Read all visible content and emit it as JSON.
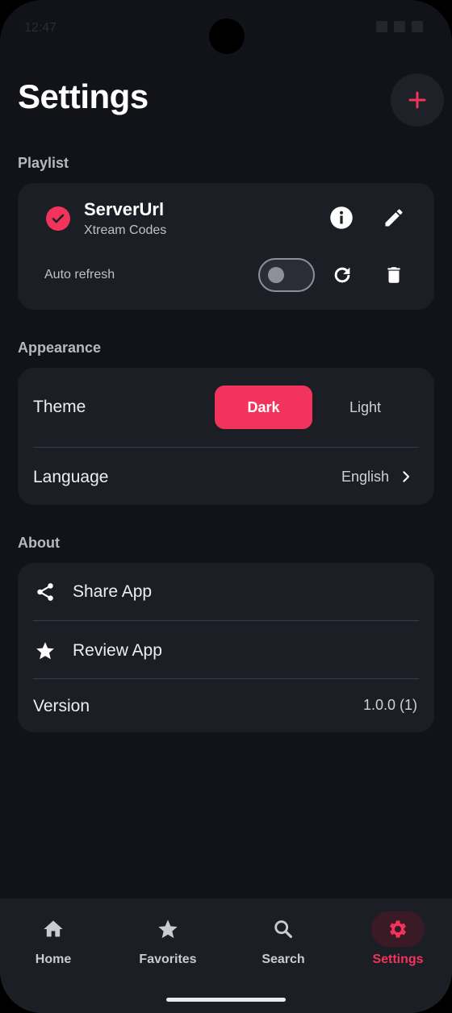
{
  "status": {
    "time": "12:47"
  },
  "header": {
    "title": "Settings",
    "add_icon": "plus-icon"
  },
  "playlist": {
    "section_label": "Playlist",
    "name": "ServerUrl",
    "type": "Xtream Codes",
    "auto_refresh_label": "Auto refresh",
    "auto_refresh_on": false
  },
  "appearance": {
    "section_label": "Appearance",
    "theme_label": "Theme",
    "theme_options": [
      "Dark",
      "Light"
    ],
    "theme_selected": "Dark",
    "language_label": "Language",
    "language_value": "English"
  },
  "about": {
    "section_label": "About",
    "share_label": "Share App",
    "review_label": "Review App",
    "version_label": "Version",
    "version_value": "1.0.0 (1)"
  },
  "nav": {
    "items": [
      {
        "label": "Home",
        "icon": "home-icon"
      },
      {
        "label": "Favorites",
        "icon": "star-icon"
      },
      {
        "label": "Search",
        "icon": "search-icon"
      },
      {
        "label": "Settings",
        "icon": "gear-icon"
      }
    ],
    "active": "Settings"
  },
  "colors": {
    "accent": "#f2345c",
    "background": "#111318",
    "card": "#1b1e25"
  }
}
